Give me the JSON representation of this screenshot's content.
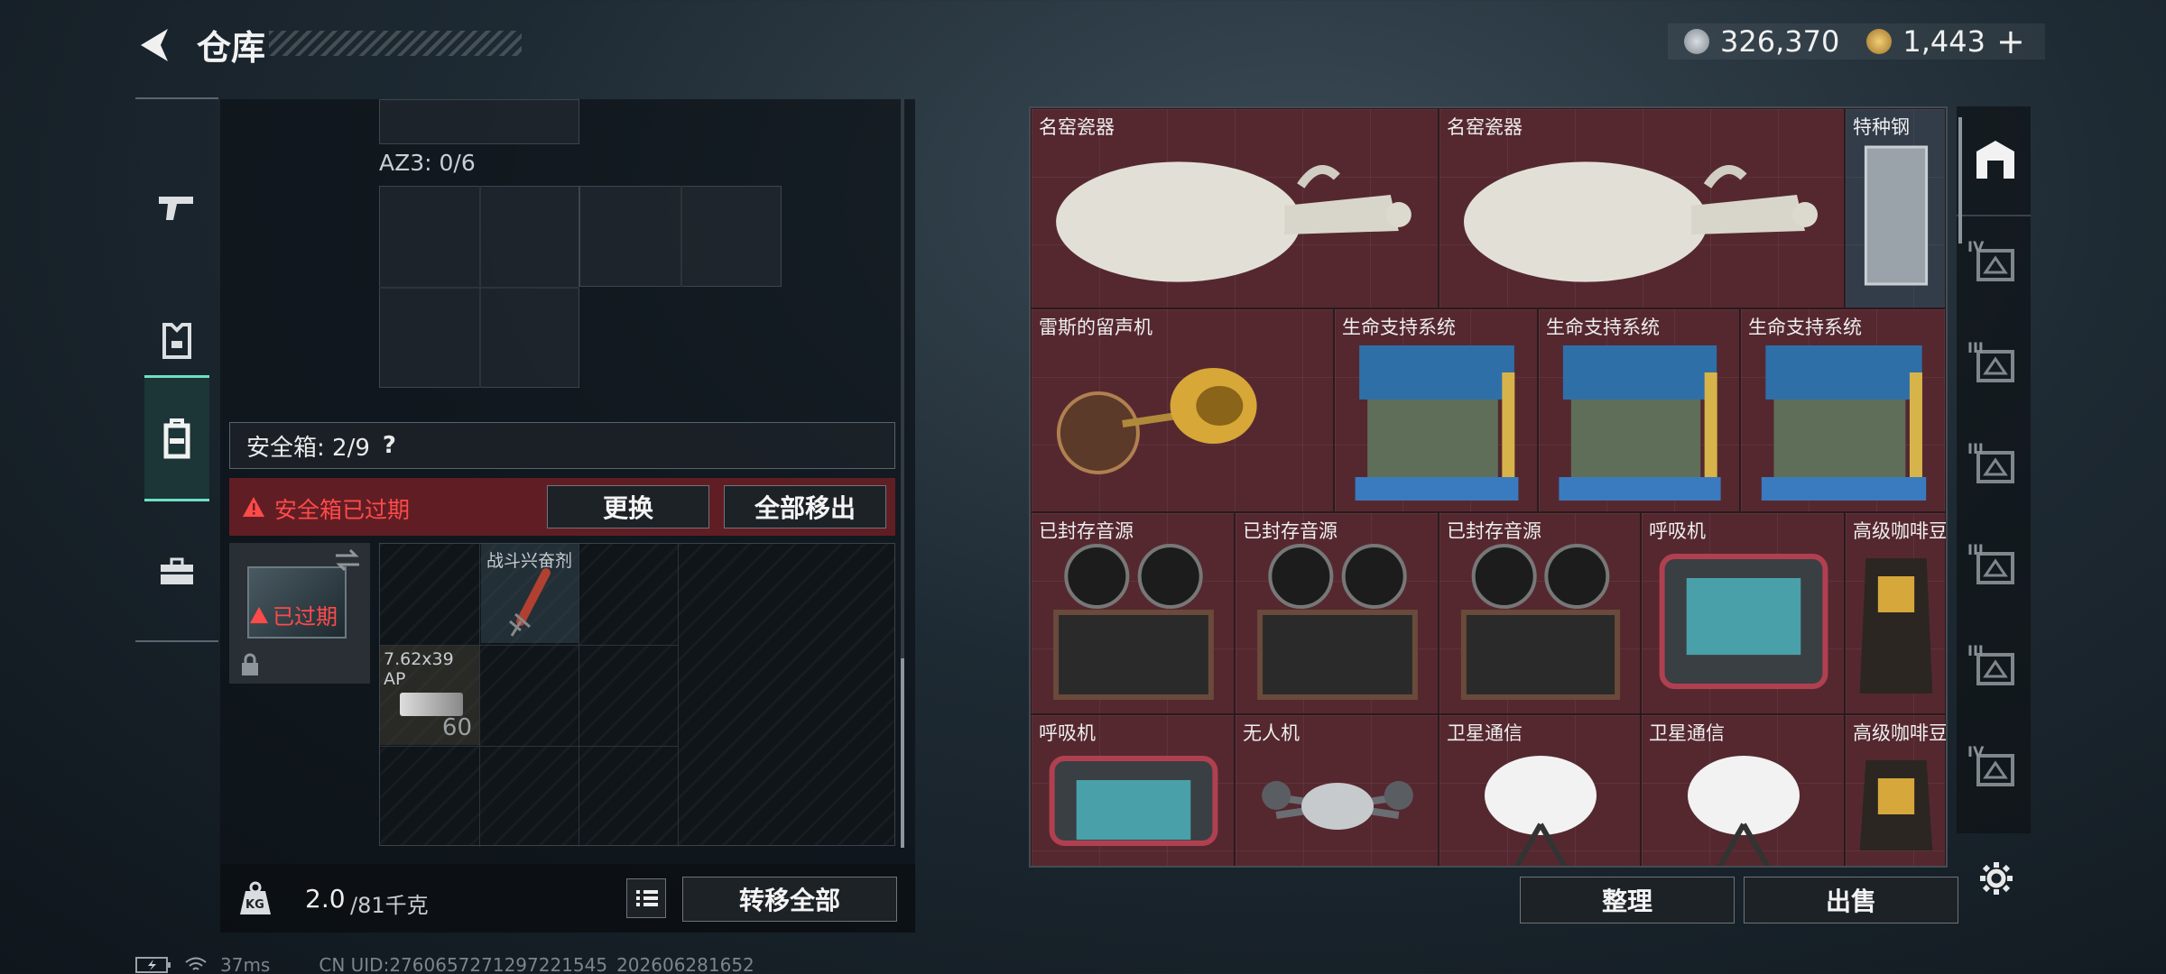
{
  "header": {
    "title": "仓库",
    "currency_primary": "326,370",
    "currency_secondary": "1,443",
    "add_label": "+"
  },
  "left": {
    "az3_label": "AZ3: 0/6",
    "safebox_label": "安全箱: 2/9",
    "help_label": "?",
    "expired_warning": "安全箱已过期",
    "replace_button": "更换",
    "move_all_out_button": "全部移出",
    "expired_tag": "已过期",
    "items": [
      {
        "name": "战斗兴奋剂"
      },
      {
        "name": "7.62x39 AP",
        "count": "60"
      }
    ],
    "weight_value": "2.0",
    "weight_max": "/81千克",
    "weight_icon_text": "KG",
    "transfer_all_button": "转移全部"
  },
  "inventory": {
    "items": [
      {
        "label": "名窑瓷器",
        "kind": "vase"
      },
      {
        "label": "名窑瓷器",
        "kind": "vase"
      },
      {
        "label": "特种钢",
        "kind": "steel"
      },
      {
        "label": "雷斯的留声机",
        "kind": "gramophone"
      },
      {
        "label": "生命支持系统",
        "kind": "engine"
      },
      {
        "label": "生命支持系统",
        "kind": "engine"
      },
      {
        "label": "生命支持系统",
        "kind": "engine"
      },
      {
        "label": "已封存音源",
        "kind": "reel"
      },
      {
        "label": "已封存音源",
        "kind": "reel"
      },
      {
        "label": "已封存音源",
        "kind": "reel"
      },
      {
        "label": "呼吸机",
        "kind": "ventilator"
      },
      {
        "label": "高级咖啡豆",
        "kind": "coffee"
      },
      {
        "label": "呼吸机",
        "kind": "ventilator"
      },
      {
        "label": "无人机",
        "kind": "drone"
      },
      {
        "label": "卫星通信",
        "kind": "satellite"
      },
      {
        "label": "卫星通信",
        "kind": "satellite"
      },
      {
        "label": "高级咖啡豆",
        "kind": "coffee"
      }
    ],
    "sort_button": "整理",
    "sell_button": "出售",
    "sidebar_tiers": [
      "IV",
      "III",
      "III",
      "III",
      "III",
      "IV"
    ]
  },
  "status": {
    "ping": "37ms",
    "uid": "CN UID:2760657271297221545_202606281652"
  },
  "colors": {
    "accent": "#6fe0c4",
    "item_bg": "#552830",
    "warning_bg": "#6e2026",
    "warning_text": "#ff4a4a"
  }
}
